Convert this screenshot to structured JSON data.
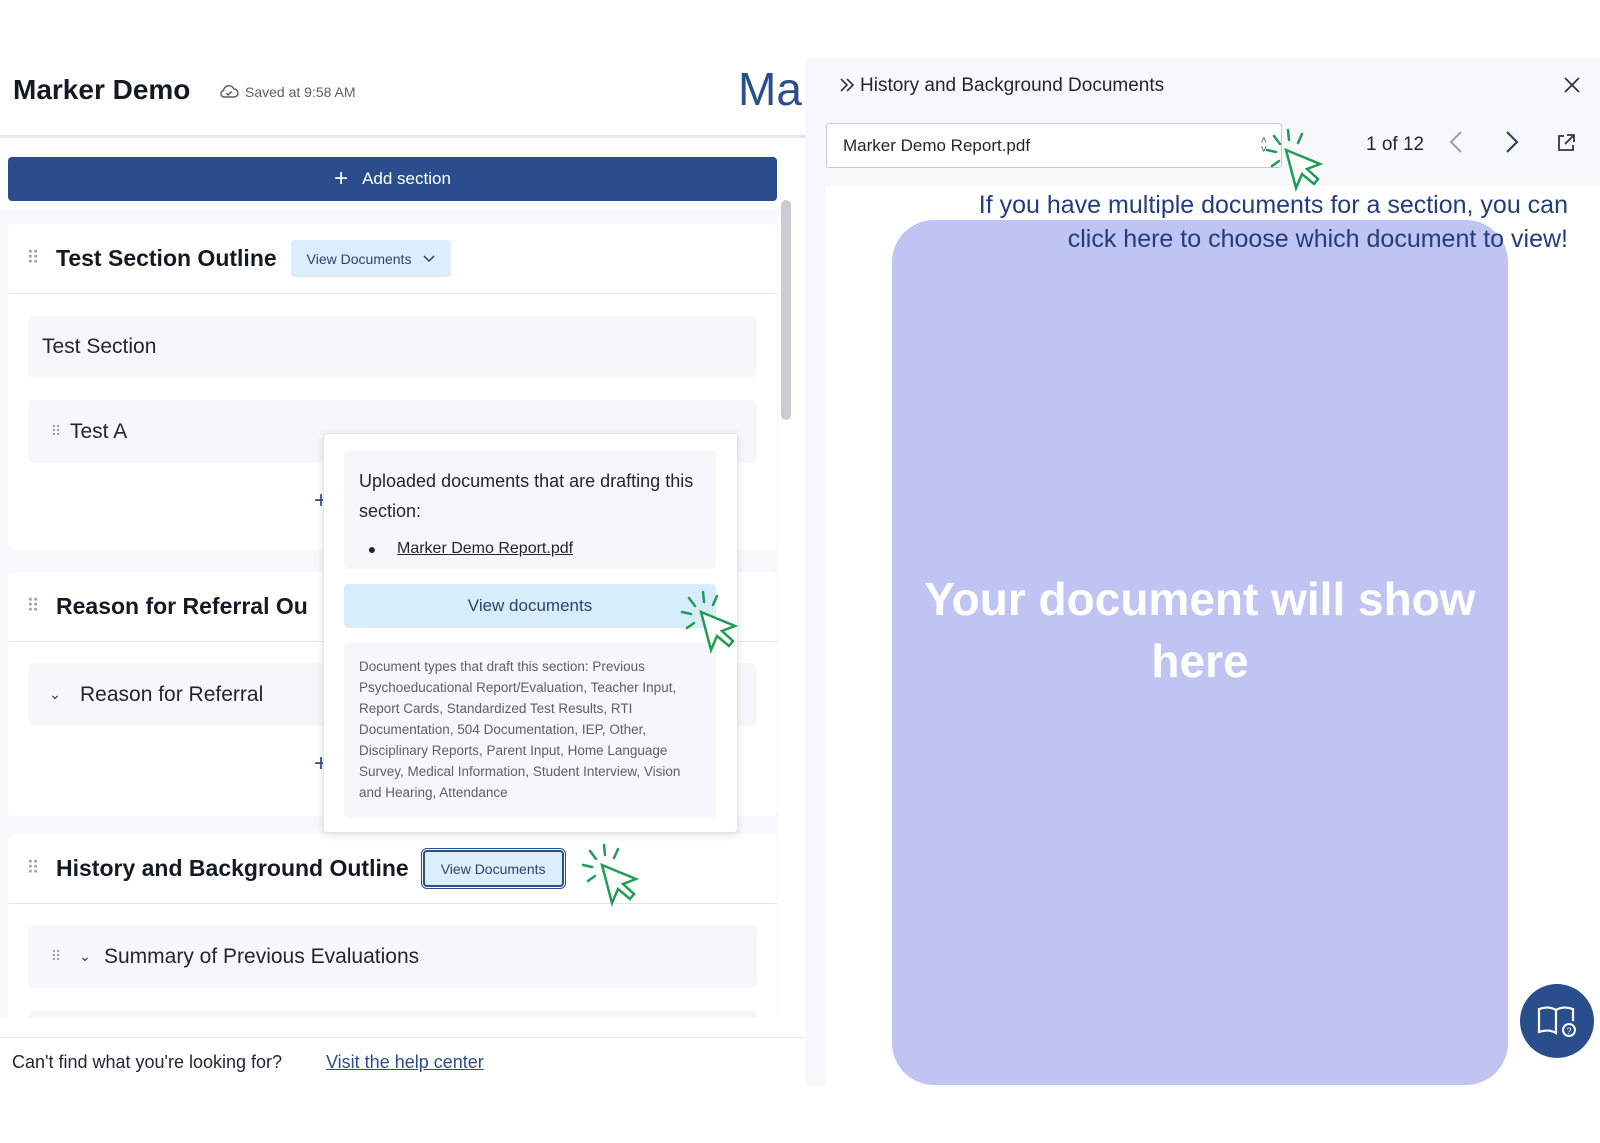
{
  "header": {
    "app_title": "Marker Demo",
    "saved_status": "Saved at 9:58 AM",
    "brand_partial": "Mar"
  },
  "toolbar": {
    "add_section_label": "Add section"
  },
  "outline": {
    "test_section": {
      "title": "Test Section Outline",
      "view_docs_label": "View Documents",
      "rows": [
        "Test Section",
        "Test A"
      ]
    },
    "referral_section": {
      "title": "Reason for Referral Ou",
      "rows": [
        "Reason for Referral"
      ]
    },
    "history_section": {
      "title": "History and Background Outline",
      "view_docs_label": "View Documents",
      "rows": [
        "Summary of Previous Evaluations"
      ]
    }
  },
  "popover": {
    "heading": "Uploaded documents that are drafting this section:",
    "documents": [
      "Marker Demo Report.pdf"
    ],
    "view_documents_label": "View documents",
    "doc_types_text": "Document types that draft this section: Previous Psychoeducational Report/Evaluation, Teacher Input, Report Cards, Standardized Test Results, RTI Documentation, 504 Documentation, IEP, Other, Disciplinary Reports, Parent Input, Home Language Survey, Medical Information, Student Interview, Vision and Hearing, Attendance"
  },
  "footer": {
    "question": "Can't find what you're looking for?",
    "help_link": "Visit the help center"
  },
  "viewer": {
    "title": "History and Background Documents",
    "selected_document": "Marker Demo Report.pdf",
    "page_indicator": "1 of 12",
    "placeholder": "Your document will show here",
    "annotation": "If you have multiple documents for a section, you can click here to choose which document to view!"
  },
  "colors": {
    "primary": "#2a4d8c",
    "light_blue": "#dceefb",
    "placeholder": "#c0c4f2",
    "cursor_green": "#1f9d55",
    "annotation_text": "#223d7d"
  },
  "icons": {
    "saved": "cloud-check-icon",
    "add": "plus-icon",
    "drag": "drag-handle-icon",
    "chevron": "chevron-down-icon",
    "collapse": "double-chevron-right-icon",
    "close": "close-icon",
    "prev": "chevron-left-icon",
    "next": "chevron-right-icon",
    "open": "open-external-icon",
    "help": "help-book-icon",
    "pointer": "click-cursor-icon"
  }
}
